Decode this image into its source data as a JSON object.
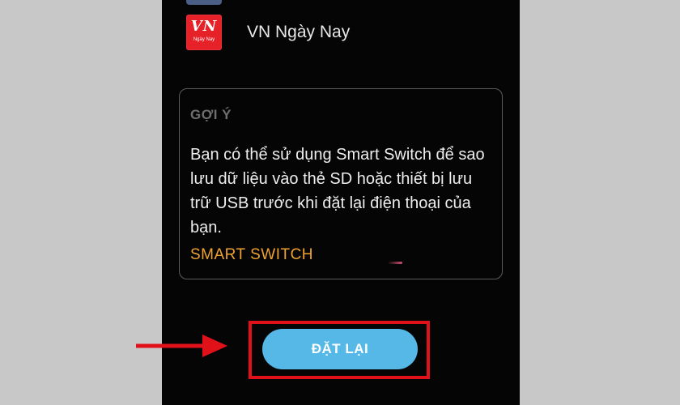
{
  "app": {
    "name": "VN Ngày Nay",
    "icon": {
      "name": "vn-ngay-nay-app-icon",
      "primary_text": "VN",
      "secondary_text": "Ngày Nay",
      "background": "#e62128"
    }
  },
  "hint": {
    "title": "GỢI Ý",
    "body": "Bạn có thể sử dụng Smart Switch để sao lưu dữ liệu vào thẻ SD hoặc thiết bị lưu trữ USB trước khi đặt lại điện thoại của bạn.",
    "link": "SMART SWITCH"
  },
  "actions": {
    "reset_label": "ĐẶT LẠI"
  },
  "annotation": {
    "highlight_color": "#e1111a",
    "arrow_color": "#e1111a"
  },
  "theme": {
    "screen_background": "#050505",
    "page_background": "#c8c8c8",
    "link_color": "#f0a22f",
    "button_color": "#55b8e6"
  }
}
